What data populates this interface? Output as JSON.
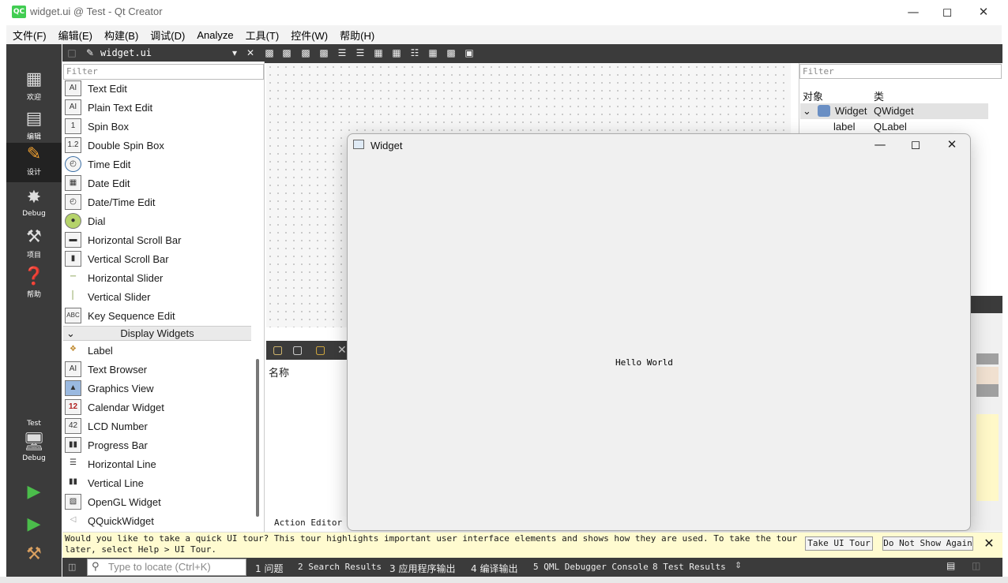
{
  "window": {
    "title": "widget.ui @ Test - Qt Creator",
    "logo": "QC"
  },
  "menu": [
    "文件(F)",
    "编辑(E)",
    "构建(B)",
    "调试(D)",
    "Analyze",
    "工具(T)",
    "控件(W)",
    "帮助(H)"
  ],
  "modes": [
    {
      "label": "欢迎",
      "icon": "grid-icon"
    },
    {
      "label": "编辑",
      "icon": "document-icon"
    },
    {
      "label": "设计",
      "icon": "pencil-icon"
    },
    {
      "label": "Debug",
      "icon": "bug-icon"
    },
    {
      "label": "项目",
      "icon": "wrench-icon"
    },
    {
      "label": "帮助",
      "icon": "question-icon"
    }
  ],
  "kit": {
    "project": "Test",
    "config": "Debug"
  },
  "toolbar": {
    "document": "widget.ui"
  },
  "widget_box": {
    "filter_placeholder": "Filter",
    "items_top": [
      "Text Edit",
      "Plain Text Edit",
      "Spin Box",
      "Double Spin Box",
      "Time Edit",
      "Date Edit",
      "Date/Time Edit",
      "Dial",
      "Horizontal Scroll Bar",
      "Vertical Scroll Bar",
      "Horizontal Slider",
      "Vertical Slider",
      "Key Sequence Edit"
    ],
    "category": "Display Widgets",
    "items_bottom": [
      "Label",
      "Text Browser",
      "Graphics View",
      "Calendar Widget",
      "LCD Number",
      "Progress Bar",
      "Horizontal Line",
      "Vertical Line",
      "OpenGL Widget",
      "QQuickWidget"
    ]
  },
  "action_editor": {
    "column": "名称",
    "label": "Action Editor"
  },
  "object_inspector": {
    "filter_placeholder": "Filter",
    "col_object": "对象",
    "col_class": "类",
    "rows": [
      {
        "object": "Widget",
        "class": "QWidget"
      },
      {
        "object": "label",
        "class": "QLabel"
      }
    ]
  },
  "preview": {
    "title": "Widget",
    "label": "Hello World"
  },
  "tour": {
    "message": "Would you like to take a quick UI tour? This tour highlights important user interface elements and shows how they are used. To take the tour later, select Help > UI Tour.",
    "take_label": "Take UI Tour",
    "dismiss_label": "Do Not Show Again"
  },
  "output": {
    "locator_placeholder": "Type to locate (Ctrl+K)",
    "tabs": [
      "1 问题",
      "2 Search Results",
      "3 应用程序输出",
      "4 编译输出",
      "5 QML Debugger Console",
      "8 Test Results"
    ]
  }
}
